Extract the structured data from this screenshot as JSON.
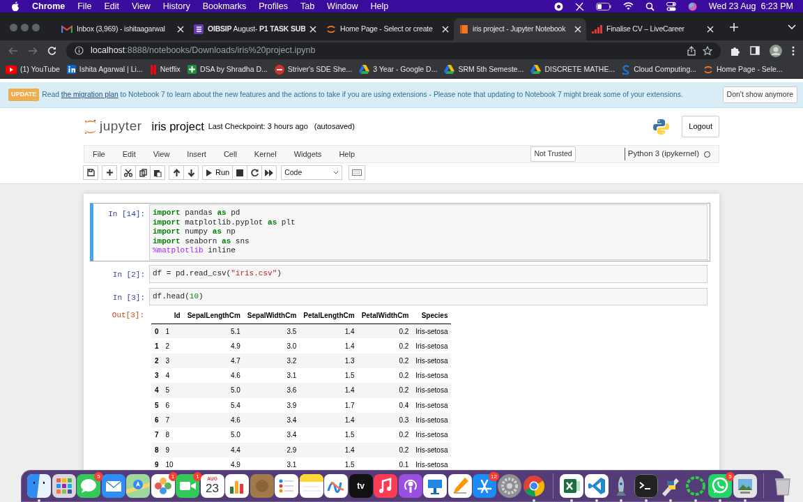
{
  "menubar": {
    "app": "Chrome",
    "menus": [
      "File",
      "Edit",
      "View",
      "History",
      "Bookmarks",
      "Profiles",
      "Tab",
      "Window",
      "Help"
    ],
    "clock": "Wed 23 Aug  6:23 PM"
  },
  "tabs": [
    {
      "title": "Inbox (3,969) - ishitaagarwal",
      "kind": "mail",
      "selected": false
    },
    {
      "title": "**OIBSIP** August- **P1 TASK SUB**",
      "kind": "form",
      "selected": false
    },
    {
      "title": "Home Page - Select or create",
      "kind": "ring",
      "selected": false
    },
    {
      "title": "iris project - Jupyter Notebook",
      "kind": "notebook",
      "selected": true
    },
    {
      "title": "Finalise CV – LiveCareer",
      "kind": "bars",
      "selected": false
    }
  ],
  "address": {
    "host": "localhost",
    "path": ":8888/notebooks/Downloads/iris%20project.ipynb"
  },
  "bookmarks": [
    {
      "title": "(1) YouTube",
      "kind": "video"
    },
    {
      "title": "Ishita Agarwal | Li...",
      "kind": "profile"
    },
    {
      "title": "Netflix",
      "kind": "ribbon"
    },
    {
      "title": "DSA by Shradha D...",
      "kind": "plus"
    },
    {
      "title": "Striver's SDE She...",
      "kind": "badge"
    },
    {
      "title": "3 Year - Google D...",
      "kind": "drive"
    },
    {
      "title": "SRM 5th Semeste...",
      "kind": "drive"
    },
    {
      "title": "DISCRETE MATHE...",
      "kind": "drive"
    },
    {
      "title": "Cloud Computing...",
      "kind": "swirl"
    },
    {
      "title": "Home Page - Sele...",
      "kind": "ring"
    }
  ],
  "notice": {
    "badge": "UPDATE",
    "before": "Read",
    "link": "the migration plan",
    "after": "to Notebook 7 to learn about the new features and the actions to take if you are using extensions - Please note that updating to Notebook 7 might break some of your extensions.",
    "button": "Don't show anymore"
  },
  "header": {
    "logo": "jupyter",
    "title": "iris project",
    "checkpoint": "Last Checkpoint: 3 hours ago",
    "autosave": "(autosaved)",
    "logout": "Logout"
  },
  "menu": {
    "items": [
      "File",
      "Edit",
      "View",
      "Insert",
      "Cell",
      "Kernel",
      "Widgets",
      "Help"
    ],
    "trust": "Not Trusted",
    "kernel": "Python 3 (ipykernel)",
    "kernel_busy": false
  },
  "toolbar": {
    "run": "Run",
    "cell_type": "Code"
  },
  "cells": [
    {
      "prompt": "In [14]:",
      "selected": true,
      "lines": [
        [
          {
            "text": "import",
            "kind": "keyword"
          },
          {
            "text": " pandas ",
            "kind": "plain"
          },
          {
            "text": "as",
            "kind": "keyword"
          },
          {
            "text": " pd",
            "kind": "plain"
          }
        ],
        [
          {
            "text": "import",
            "kind": "keyword"
          },
          {
            "text": " matplotlib.pyplot ",
            "kind": "plain"
          },
          {
            "text": "as",
            "kind": "keyword"
          },
          {
            "text": " plt",
            "kind": "plain"
          }
        ],
        [
          {
            "text": "import",
            "kind": "keyword"
          },
          {
            "text": " numpy ",
            "kind": "plain"
          },
          {
            "text": "as",
            "kind": "keyword"
          },
          {
            "text": " np",
            "kind": "plain"
          }
        ],
        [
          {
            "text": "import",
            "kind": "keyword"
          },
          {
            "text": " seaborn ",
            "kind": "plain"
          },
          {
            "text": "as",
            "kind": "keyword"
          },
          {
            "text": " sns",
            "kind": "plain"
          }
        ],
        [
          {
            "text": "%matplotlib",
            "kind": "magic"
          },
          {
            "text": " inline",
            "kind": "plain"
          }
        ]
      ]
    },
    {
      "prompt": "In [2]:",
      "selected": false,
      "lines": [
        [
          {
            "text": "df = pd.read_csv(",
            "kind": "plain"
          },
          {
            "text": "\"iris.csv\"",
            "kind": "string"
          },
          {
            "text": ")",
            "kind": "plain"
          }
        ]
      ]
    },
    {
      "prompt": "In [3]:",
      "selected": false,
      "lines": [
        [
          {
            "text": "df.head(",
            "kind": "plain"
          },
          {
            "text": "10",
            "kind": "number"
          },
          {
            "text": ")",
            "kind": "plain"
          }
        ]
      ],
      "output": {
        "prompt": "Out[3]:",
        "columns": [
          "Id",
          "SepalLengthCm",
          "SepalWidthCm",
          "PetalLengthCm",
          "PetalWidthCm",
          "Species"
        ],
        "rows": [
          {
            "index": "0",
            "cells": [
              "1",
              "5.1",
              "3.5",
              "1.4",
              "0.2",
              "Iris-setosa"
            ]
          },
          {
            "index": "1",
            "cells": [
              "2",
              "4.9",
              "3.0",
              "1.4",
              "0.2",
              "Iris-setosa"
            ]
          },
          {
            "index": "2",
            "cells": [
              "3",
              "4.7",
              "3.2",
              "1.3",
              "0.2",
              "Iris-setosa"
            ]
          },
          {
            "index": "3",
            "cells": [
              "4",
              "4.6",
              "3.1",
              "1.5",
              "0.2",
              "Iris-setosa"
            ]
          },
          {
            "index": "4",
            "cells": [
              "5",
              "5.0",
              "3.6",
              "1.4",
              "0.2",
              "Iris-setosa"
            ]
          },
          {
            "index": "5",
            "cells": [
              "6",
              "5.4",
              "3.9",
              "1.7",
              "0.4",
              "Iris-setosa"
            ]
          },
          {
            "index": "6",
            "cells": [
              "7",
              "4.6",
              "3.4",
              "1.4",
              "0.3",
              "Iris-setosa"
            ]
          },
          {
            "index": "7",
            "cells": [
              "8",
              "5.0",
              "3.4",
              "1.5",
              "0.2",
              "Iris-setosa"
            ]
          },
          {
            "index": "8",
            "cells": [
              "9",
              "4.4",
              "2.9",
              "1.4",
              "0.2",
              "Iris-setosa"
            ]
          },
          {
            "index": "9",
            "cells": [
              "10",
              "4.9",
              "3.1",
              "1.5",
              "0.1",
              "Iris-setosa"
            ]
          }
        ]
      }
    }
  ],
  "dock": [
    {
      "running": true
    },
    {
      "running": false
    },
    {
      "badge": "5",
      "running": false
    },
    {
      "running": false
    },
    {
      "running": false
    },
    {
      "badge": "1",
      "running": false
    },
    {
      "badge": "1",
      "running": false
    },
    {
      "texts": [
        "AUG",
        "23"
      ],
      "running": false
    },
    {
      "running": false
    },
    {
      "running": false
    },
    {
      "running": false
    },
    {
      "running": false
    },
    {
      "running": false
    },
    {
      "texts": [
        "tv"
      ],
      "running": false
    },
    {
      "running": false
    },
    {
      "running": false
    },
    {
      "running": false
    },
    {
      "running": false
    },
    {
      "badge": "12",
      "running": false
    },
    {
      "running": false
    },
    {
      "running": true
    },
    {
      "running": true
    },
    {
      "running": true
    },
    {
      "running": true
    },
    {
      "running": true
    },
    {
      "running": true
    },
    {
      "running": true
    },
    {
      "badge": "5",
      "running": true
    },
    {
      "running": true
    },
    {
      "running": false
    }
  ]
}
